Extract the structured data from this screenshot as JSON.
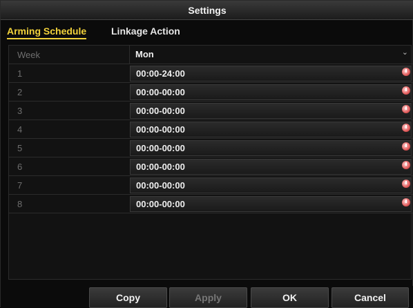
{
  "window": {
    "title": "Settings"
  },
  "tabs": [
    {
      "label": "Arming Schedule",
      "active": true
    },
    {
      "label": "Linkage Action",
      "active": false
    }
  ],
  "schedule": {
    "header_label": "Week",
    "header_value": "Mon",
    "rows": [
      {
        "label": "1",
        "value": "00:00-24:00"
      },
      {
        "label": "2",
        "value": "00:00-00:00"
      },
      {
        "label": "3",
        "value": "00:00-00:00"
      },
      {
        "label": "4",
        "value": "00:00-00:00"
      },
      {
        "label": "5",
        "value": "00:00-00:00"
      },
      {
        "label": "6",
        "value": "00:00-00:00"
      },
      {
        "label": "7",
        "value": "00:00-00:00"
      },
      {
        "label": "8",
        "value": "00:00-00:00"
      }
    ]
  },
  "buttons": {
    "copy": "Copy",
    "apply": "Apply",
    "ok": "OK",
    "cancel": "Cancel"
  },
  "colors": {
    "active_tab": "#f2d23b",
    "clock_icon": "#e05a5a"
  }
}
